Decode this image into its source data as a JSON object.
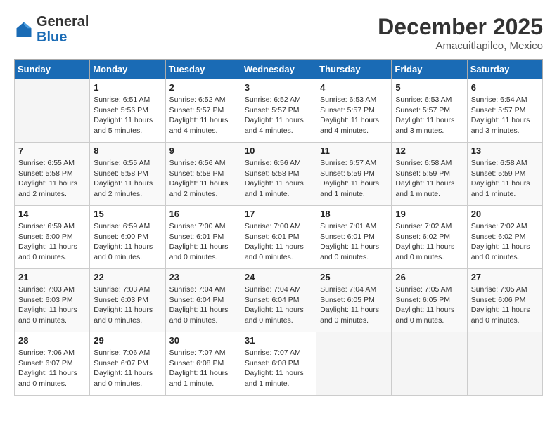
{
  "header": {
    "logo_general": "General",
    "logo_blue": "Blue",
    "month": "December 2025",
    "location": "Amacuitlapilco, Mexico"
  },
  "weekdays": [
    "Sunday",
    "Monday",
    "Tuesday",
    "Wednesday",
    "Thursday",
    "Friday",
    "Saturday"
  ],
  "weeks": [
    [
      {
        "day": "",
        "info": ""
      },
      {
        "day": "1",
        "info": "Sunrise: 6:51 AM\nSunset: 5:56 PM\nDaylight: 11 hours\nand 5 minutes."
      },
      {
        "day": "2",
        "info": "Sunrise: 6:52 AM\nSunset: 5:57 PM\nDaylight: 11 hours\nand 4 minutes."
      },
      {
        "day": "3",
        "info": "Sunrise: 6:52 AM\nSunset: 5:57 PM\nDaylight: 11 hours\nand 4 minutes."
      },
      {
        "day": "4",
        "info": "Sunrise: 6:53 AM\nSunset: 5:57 PM\nDaylight: 11 hours\nand 4 minutes."
      },
      {
        "day": "5",
        "info": "Sunrise: 6:53 AM\nSunset: 5:57 PM\nDaylight: 11 hours\nand 3 minutes."
      },
      {
        "day": "6",
        "info": "Sunrise: 6:54 AM\nSunset: 5:57 PM\nDaylight: 11 hours\nand 3 minutes."
      }
    ],
    [
      {
        "day": "7",
        "info": "Sunrise: 6:55 AM\nSunset: 5:58 PM\nDaylight: 11 hours\nand 2 minutes."
      },
      {
        "day": "8",
        "info": "Sunrise: 6:55 AM\nSunset: 5:58 PM\nDaylight: 11 hours\nand 2 minutes."
      },
      {
        "day": "9",
        "info": "Sunrise: 6:56 AM\nSunset: 5:58 PM\nDaylight: 11 hours\nand 2 minutes."
      },
      {
        "day": "10",
        "info": "Sunrise: 6:56 AM\nSunset: 5:58 PM\nDaylight: 11 hours\nand 1 minute."
      },
      {
        "day": "11",
        "info": "Sunrise: 6:57 AM\nSunset: 5:59 PM\nDaylight: 11 hours\nand 1 minute."
      },
      {
        "day": "12",
        "info": "Sunrise: 6:58 AM\nSunset: 5:59 PM\nDaylight: 11 hours\nand 1 minute."
      },
      {
        "day": "13",
        "info": "Sunrise: 6:58 AM\nSunset: 5:59 PM\nDaylight: 11 hours\nand 1 minute."
      }
    ],
    [
      {
        "day": "14",
        "info": "Sunrise: 6:59 AM\nSunset: 6:00 PM\nDaylight: 11 hours\nand 0 minutes."
      },
      {
        "day": "15",
        "info": "Sunrise: 6:59 AM\nSunset: 6:00 PM\nDaylight: 11 hours\nand 0 minutes."
      },
      {
        "day": "16",
        "info": "Sunrise: 7:00 AM\nSunset: 6:01 PM\nDaylight: 11 hours\nand 0 minutes."
      },
      {
        "day": "17",
        "info": "Sunrise: 7:00 AM\nSunset: 6:01 PM\nDaylight: 11 hours\nand 0 minutes."
      },
      {
        "day": "18",
        "info": "Sunrise: 7:01 AM\nSunset: 6:01 PM\nDaylight: 11 hours\nand 0 minutes."
      },
      {
        "day": "19",
        "info": "Sunrise: 7:02 AM\nSunset: 6:02 PM\nDaylight: 11 hours\nand 0 minutes."
      },
      {
        "day": "20",
        "info": "Sunrise: 7:02 AM\nSunset: 6:02 PM\nDaylight: 11 hours\nand 0 minutes."
      }
    ],
    [
      {
        "day": "21",
        "info": "Sunrise: 7:03 AM\nSunset: 6:03 PM\nDaylight: 11 hours\nand 0 minutes."
      },
      {
        "day": "22",
        "info": "Sunrise: 7:03 AM\nSunset: 6:03 PM\nDaylight: 11 hours\nand 0 minutes."
      },
      {
        "day": "23",
        "info": "Sunrise: 7:04 AM\nSunset: 6:04 PM\nDaylight: 11 hours\nand 0 minutes."
      },
      {
        "day": "24",
        "info": "Sunrise: 7:04 AM\nSunset: 6:04 PM\nDaylight: 11 hours\nand 0 minutes."
      },
      {
        "day": "25",
        "info": "Sunrise: 7:04 AM\nSunset: 6:05 PM\nDaylight: 11 hours\nand 0 minutes."
      },
      {
        "day": "26",
        "info": "Sunrise: 7:05 AM\nSunset: 6:05 PM\nDaylight: 11 hours\nand 0 minutes."
      },
      {
        "day": "27",
        "info": "Sunrise: 7:05 AM\nSunset: 6:06 PM\nDaylight: 11 hours\nand 0 minutes."
      }
    ],
    [
      {
        "day": "28",
        "info": "Sunrise: 7:06 AM\nSunset: 6:07 PM\nDaylight: 11 hours\nand 0 minutes."
      },
      {
        "day": "29",
        "info": "Sunrise: 7:06 AM\nSunset: 6:07 PM\nDaylight: 11 hours\nand 0 minutes."
      },
      {
        "day": "30",
        "info": "Sunrise: 7:07 AM\nSunset: 6:08 PM\nDaylight: 11 hours\nand 1 minute."
      },
      {
        "day": "31",
        "info": "Sunrise: 7:07 AM\nSunset: 6:08 PM\nDaylight: 11 hours\nand 1 minute."
      },
      {
        "day": "",
        "info": ""
      },
      {
        "day": "",
        "info": ""
      },
      {
        "day": "",
        "info": ""
      }
    ]
  ]
}
